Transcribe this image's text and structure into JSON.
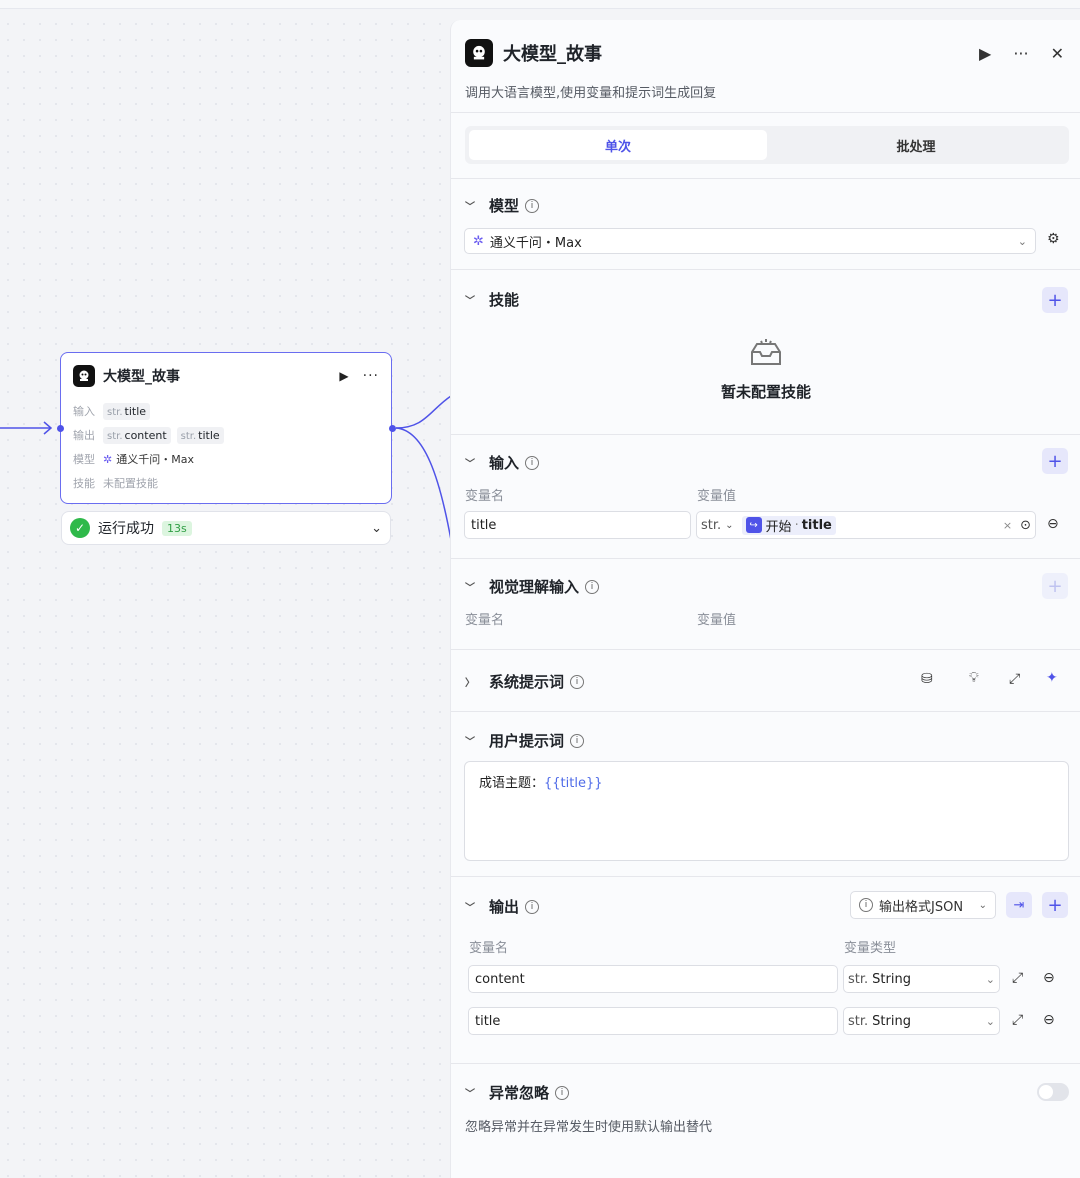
{
  "node": {
    "title": "大模型_故事",
    "input_label": "输入",
    "input_tags": [
      {
        "type": "str.",
        "name": "title"
      }
    ],
    "output_label": "输出",
    "output_tags": [
      {
        "type": "str.",
        "name": "content"
      },
      {
        "type": "str.",
        "name": "title"
      }
    ],
    "model_label": "模型",
    "model_value": "通义千问・Max",
    "skill_label": "技能",
    "skill_value": "未配置技能",
    "run_status": "运行成功",
    "run_time": "13s"
  },
  "panel": {
    "title": "大模型_故事",
    "description": "调用大语言模型,使用变量和提示词生成回复",
    "tabs": [
      {
        "label": "单次",
        "active": true
      },
      {
        "label": "批处理",
        "active": false
      }
    ],
    "model": {
      "title": "模型",
      "value": "通义千问・Max"
    },
    "skills": {
      "title": "技能",
      "empty_text": "暂未配置技能"
    },
    "input": {
      "title": "输入",
      "col_name": "变量名",
      "col_value": "变量值",
      "row": {
        "name": "title",
        "type": "str.",
        "ref_source": "开始",
        "ref_var": "title"
      }
    },
    "vision": {
      "title": "视觉理解输入",
      "col_name": "变量名",
      "col_value": "变量值"
    },
    "system_prompt": {
      "title": "系统提示词"
    },
    "user_prompt": {
      "title": "用户提示词",
      "text_prefix": "成语主题：",
      "text_var": "{{title}}"
    },
    "output": {
      "title": "输出",
      "format_label": "输出格式JSON",
      "col_name": "变量名",
      "col_type": "变量类型",
      "rows": [
        {
          "name": "content",
          "type_prefix": "str.",
          "type": "String"
        },
        {
          "name": "title",
          "type_prefix": "str.",
          "type": "String"
        }
      ]
    },
    "exception": {
      "title": "异常忽略",
      "description": "忽略异常并在异常发生时使用默认输出替代",
      "enabled": false
    }
  },
  "colors": {
    "accent": "#4f53e8",
    "success": "#2fb94a"
  }
}
